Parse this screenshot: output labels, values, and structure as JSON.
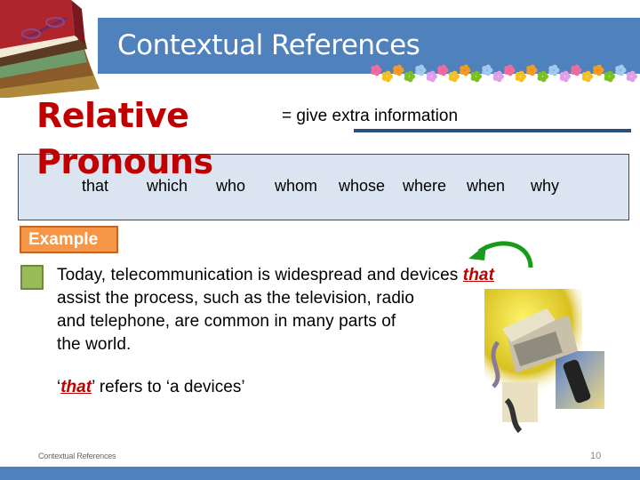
{
  "header": {
    "title": "Contextual References"
  },
  "topic": {
    "heading_line1": "Relative",
    "heading_line2": "Pronouns",
    "definition": "= give extra information",
    "pronouns": [
      "that",
      "which",
      "who",
      "whom",
      "whose",
      "where",
      "when",
      "why"
    ]
  },
  "example": {
    "label": "Example",
    "sentence_line1_pre": "Today, telecommunication is widespread and devices ",
    "highlight_word": "that",
    "sentence_line2": "assist the process, such as the television, radio",
    "sentence_line3": "and telephone, are common in many parts of",
    "sentence_line4": "the world.",
    "explanation_open_quote": "‘",
    "explanation_word": "that",
    "explanation_rest": "’ refers to ‘a devices’"
  },
  "footer": {
    "text": "Contextual References",
    "page_number": "10"
  },
  "colors": {
    "banner": "#4f81bd",
    "heading": "#c00000",
    "example_label": "#f79646",
    "bullet": "#9bbb59",
    "pronoun_box": "#dbe5f1",
    "arrow": "#1a9a1a"
  }
}
